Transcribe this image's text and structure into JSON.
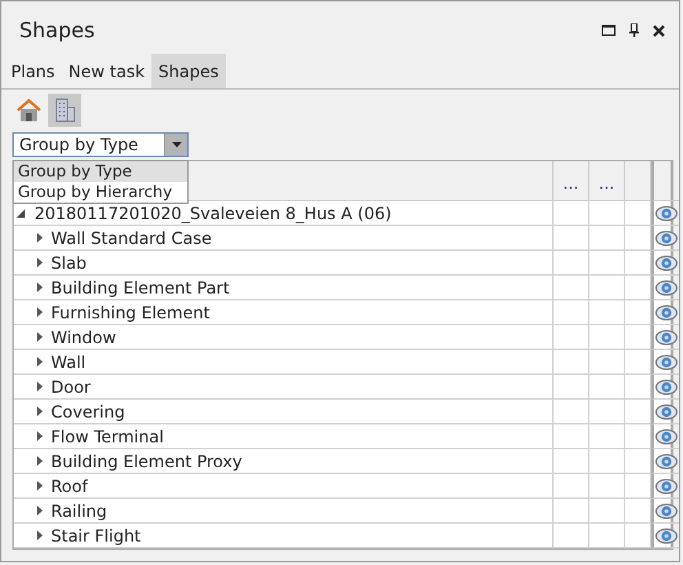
{
  "window": {
    "title": "Shapes"
  },
  "tabs": [
    {
      "label": "Plans",
      "selected": false
    },
    {
      "label": "New task",
      "selected": false
    },
    {
      "label": "Shapes",
      "selected": true
    }
  ],
  "toolbar": [
    {
      "kind": "house",
      "selected": false
    },
    {
      "kind": "building",
      "selected": true
    }
  ],
  "group_combo": {
    "value": "Group by Type",
    "expanded": true,
    "options": [
      {
        "label": "Group by Type",
        "selected": true
      },
      {
        "label": "Group by Hierarchy",
        "selected": false
      }
    ]
  },
  "table": {
    "column_headers": [
      "...",
      "..."
    ],
    "tree": [
      {
        "name": "20180117201020_Svaleveien 8_Hus A (06)",
        "expanded": true,
        "visible": true,
        "children": [
          {
            "name": "Wall Standard Case",
            "expanded": false,
            "visible": true
          },
          {
            "name": "Slab",
            "expanded": false,
            "visible": true
          },
          {
            "name": "Building Element Part",
            "expanded": false,
            "visible": true
          },
          {
            "name": "Furnishing Element",
            "expanded": false,
            "visible": true
          },
          {
            "name": "Window",
            "expanded": false,
            "visible": true
          },
          {
            "name": "Wall",
            "expanded": false,
            "visible": true
          },
          {
            "name": "Door",
            "expanded": false,
            "visible": true
          },
          {
            "name": "Covering",
            "expanded": false,
            "visible": true
          },
          {
            "name": "Flow Terminal",
            "expanded": false,
            "visible": true
          },
          {
            "name": "Building Element Proxy",
            "expanded": false,
            "visible": true
          },
          {
            "name": "Roof",
            "expanded": false,
            "visible": true
          },
          {
            "name": "Railing",
            "expanded": false,
            "visible": true
          },
          {
            "name": "Stair Flight",
            "expanded": false,
            "visible": true
          }
        ]
      }
    ]
  }
}
